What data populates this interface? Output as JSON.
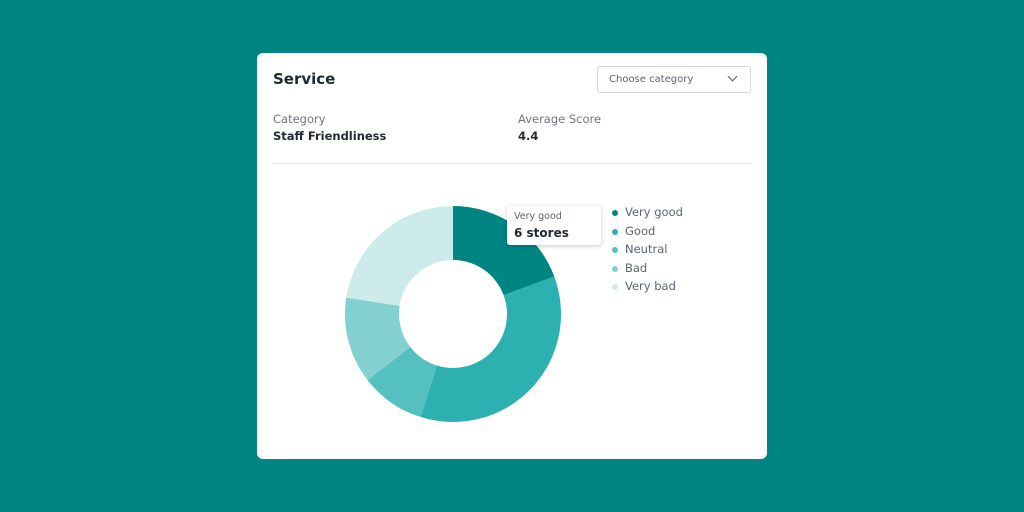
{
  "card": {
    "title": "Service",
    "dropdown": {
      "placeholder": "Choose category",
      "icon": "chevron-down-icon"
    }
  },
  "summary": {
    "category_label": "Category",
    "category_value": "Staff Friendliness",
    "score_label": "Average Score",
    "score_value": "4.4"
  },
  "tooltip": {
    "label": "Very good",
    "value": "6 stores"
  },
  "chart_data": {
    "type": "pie",
    "variant": "donut",
    "categories": [
      "Very good",
      "Good",
      "Neutral",
      "Bad",
      "Very bad"
    ],
    "values": [
      6,
      11,
      3,
      4,
      7
    ],
    "colors": [
      "#008583",
      "#2db0b0",
      "#55c0c0",
      "#82d0cf",
      "#cdebeb"
    ],
    "legend": "right",
    "start_angle": "top, clockwise"
  }
}
